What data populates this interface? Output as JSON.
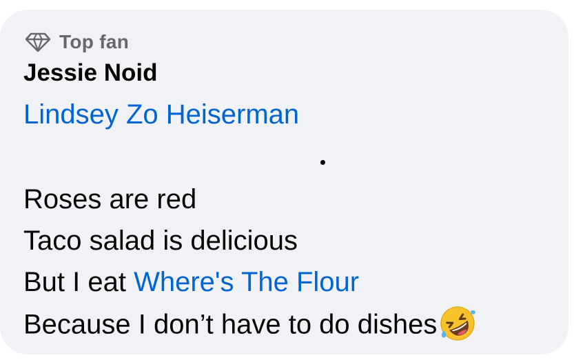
{
  "comment": {
    "badge": {
      "icon": "diamond-icon",
      "label": "Top fan"
    },
    "author": "Jessie Noid",
    "mention": "Lindsey Zo Heiserman",
    "lines": {
      "line1": "Roses are red",
      "line2": "Taco salad is delicious",
      "line3_prefix": "But I eat ",
      "line3_link": "Where's The Flour",
      "line4": "Because I don’t have to do dishes"
    },
    "emoji": "rolling-on-the-floor-laughing-emoji"
  },
  "colors": {
    "bubble_bg": "#f0f2f5",
    "link": "#0064d1",
    "text": "#050505",
    "muted": "#65676b"
  }
}
